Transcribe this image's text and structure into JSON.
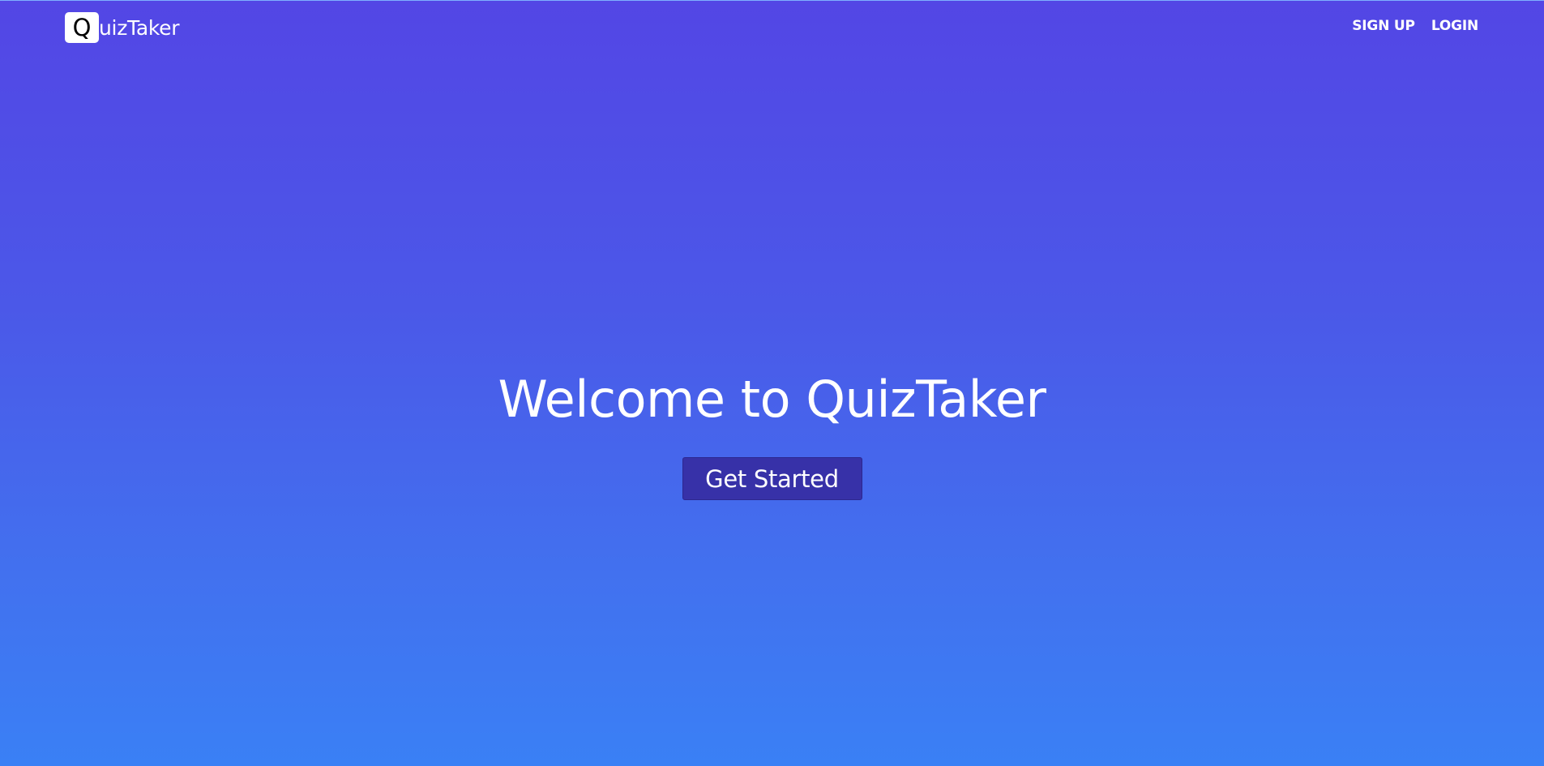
{
  "brand": {
    "logo_letter": "Q",
    "logo_rest": "uizTaker"
  },
  "nav": {
    "signup_label": "SIGN UP",
    "login_label": "LOGIN"
  },
  "hero": {
    "title": "Welcome to QuizTaker",
    "cta_label": "Get Started"
  },
  "colors": {
    "gradient_top": "#5346e5",
    "gradient_bottom": "#3a80f5",
    "button_bg": "#3731a8",
    "text": "#ffffff"
  }
}
